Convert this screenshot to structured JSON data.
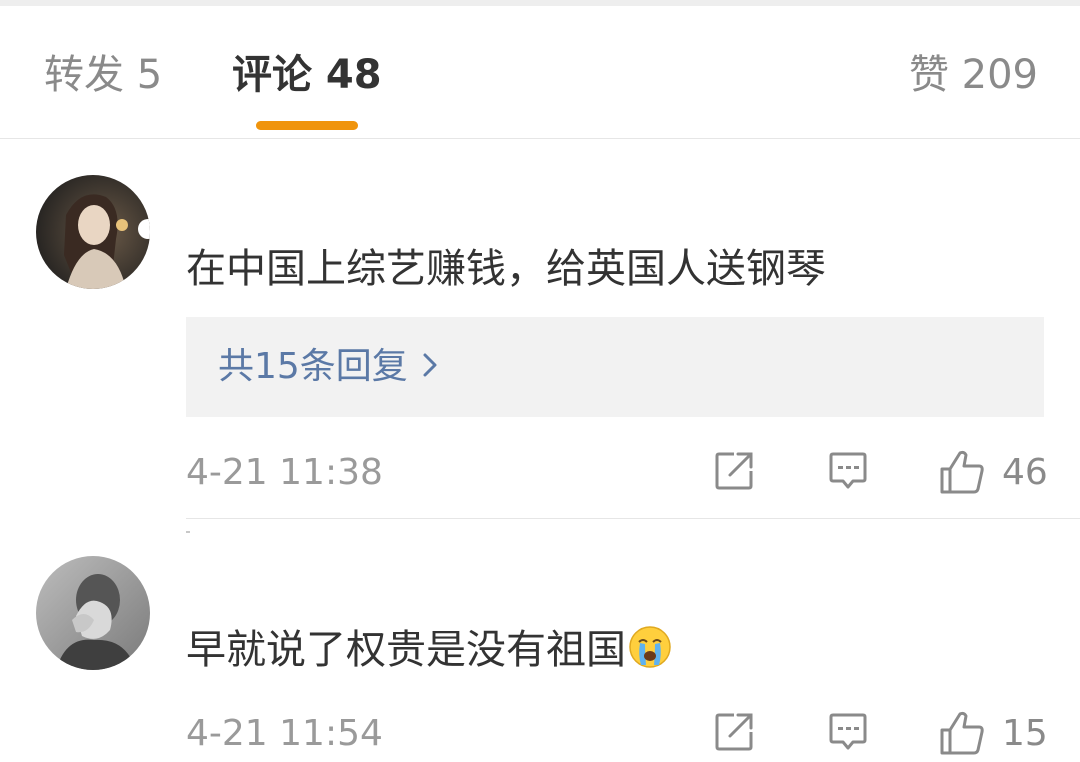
{
  "tabs": {
    "repost": "转发 5",
    "comments": "评论 48",
    "likes": "赞 209"
  },
  "accent_color": "#f0940c",
  "link_color": "#5b79a6",
  "comments": [
    {
      "text": "在中国上综艺赚钱，给英国人送钢琴",
      "replies_label": "共15条回复",
      "timestamp": "4-21 11:38",
      "like_count": "46",
      "icons": [
        "share-icon",
        "comment-icon",
        "thumbs-up-icon"
      ]
    },
    {
      "text": "早就说了权贵是没有祖国",
      "emoji": "crying-face-emoji",
      "timestamp": "4-21 11:54",
      "like_count": "15",
      "icons": [
        "share-icon",
        "comment-icon",
        "thumbs-up-icon"
      ]
    }
  ]
}
